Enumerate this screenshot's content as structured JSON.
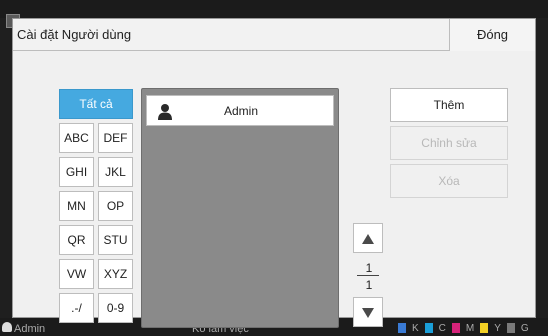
{
  "dialog": {
    "title": "Cài đặt Người dùng",
    "close_label": "Đóng"
  },
  "filters": {
    "all_label": "Tất cả",
    "items": [
      "ABC",
      "DEF",
      "GHI",
      "JKL",
      "MN",
      "OP",
      "QR",
      "STU",
      "VW",
      "XYZ",
      ".-/",
      "0-9"
    ]
  },
  "user_list": {
    "users": [
      {
        "name": "Admin"
      }
    ]
  },
  "pager": {
    "current": "1",
    "total": "1"
  },
  "actions": {
    "add_label": "Thêm",
    "edit_label": "Chỉnh sửa",
    "delete_label": "Xóa"
  },
  "status_bar": {
    "user": "Admin",
    "mode": "Ko làm việc",
    "toner_labels": [
      "K",
      "C",
      "M",
      "Y",
      "G"
    ]
  },
  "colors": {
    "accent": "#45a9e0",
    "list_bg": "#8a8a8a",
    "toner_k": "#222222",
    "toner_c": "#1a9fd9",
    "toner_m": "#d6237a",
    "toner_y": "#f2d024",
    "toner_g": "#7a7a7a"
  }
}
